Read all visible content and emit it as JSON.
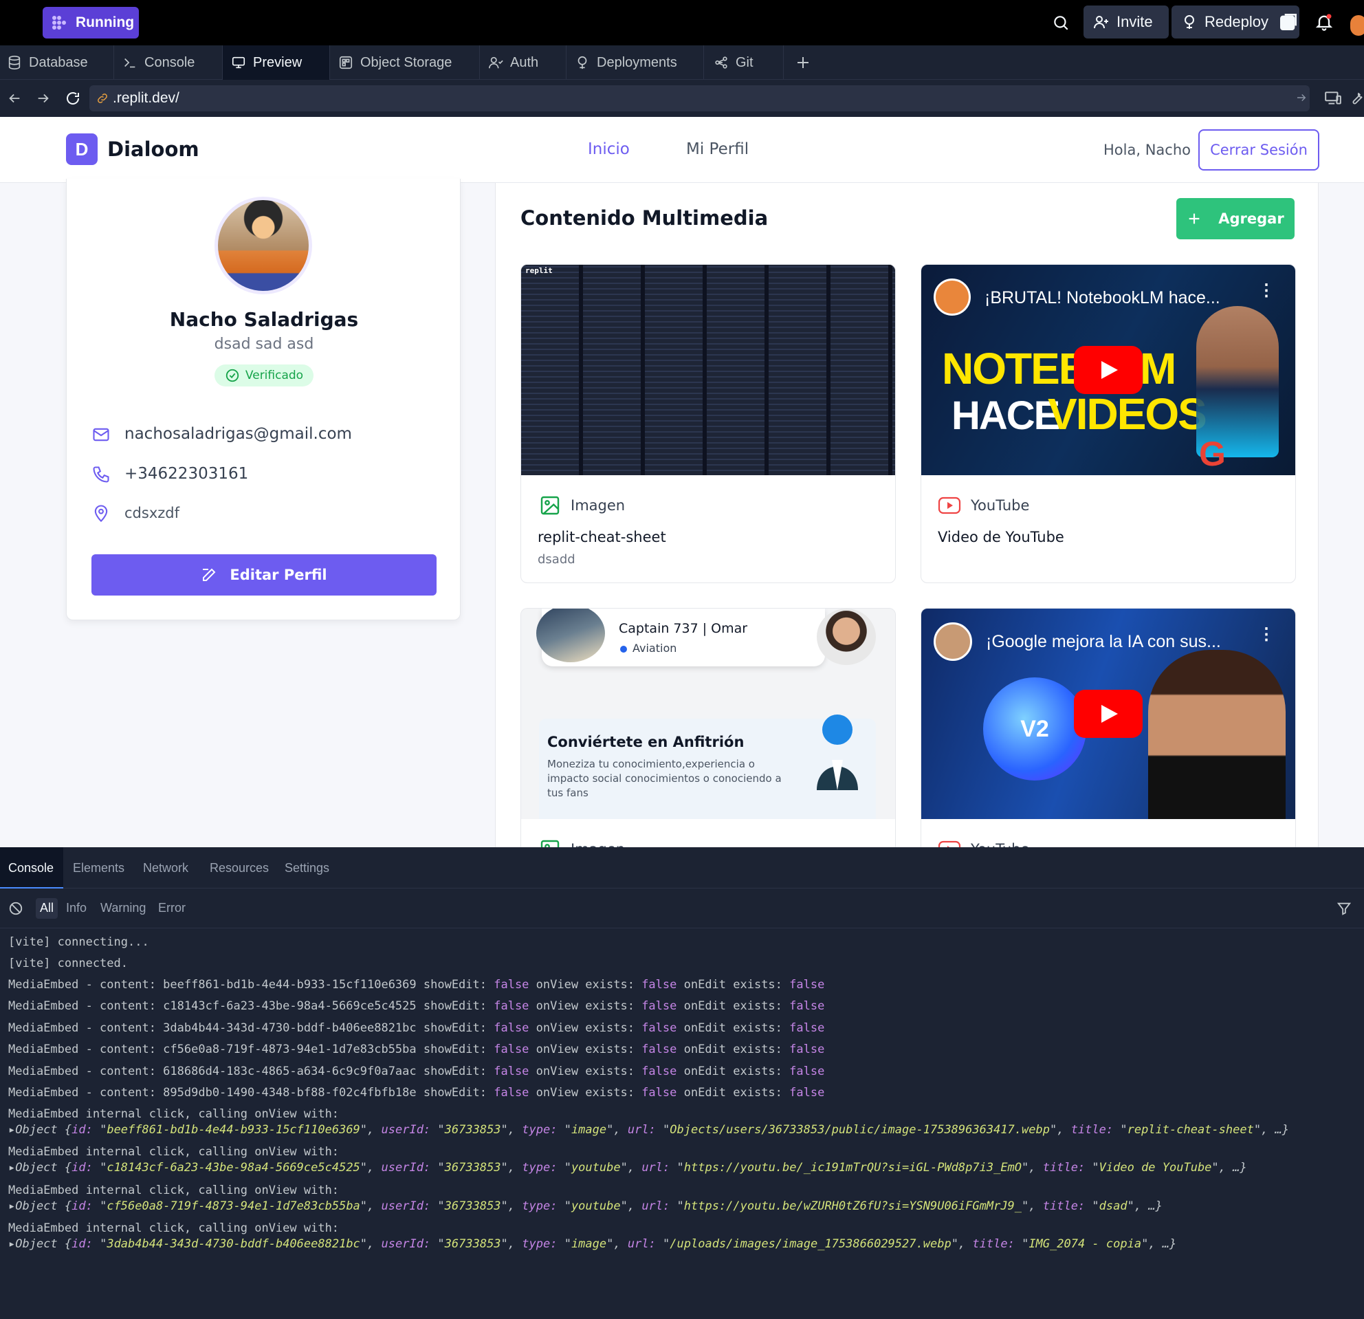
{
  "topbar": {
    "status": "Running",
    "invite": "Invite",
    "redeploy": "Redeploy",
    "colors": {
      "status_bg": "#5b3fd6",
      "notification_dot": "#ff3d3d"
    }
  },
  "tabs": [
    {
      "label": "Database",
      "icon": "database-icon"
    },
    {
      "label": "Console",
      "icon": "terminal-icon"
    },
    {
      "label": "Preview",
      "icon": "monitor-icon",
      "active": true
    },
    {
      "label": "Object Storage",
      "icon": "storage-icon"
    },
    {
      "label": "Auth",
      "icon": "user-icon"
    },
    {
      "label": "Deployments",
      "icon": "deploy-icon"
    },
    {
      "label": "Git",
      "icon": "git-icon"
    }
  ],
  "browser": {
    "url": ".replit.dev/"
  },
  "site": {
    "logo_letter": "D",
    "brand": "Dialoom",
    "nav": {
      "home": "Inicio",
      "profile": "Mi Perfil"
    },
    "greeting": "Hola, Nacho",
    "logout": "Cerrar Sesión",
    "colors": {
      "accent": "#6d5cf0",
      "agregar": "#2ec37c"
    }
  },
  "profile": {
    "name": "Nacho Saladrigas",
    "subtitle": "dsad sad asd",
    "badge": "Verificado",
    "email": "nachosaladrigas@gmail.com",
    "phone": "+34622303161",
    "location": "cdsxzdf",
    "edit": "Editar Perfil"
  },
  "media": {
    "title": "Contenido Multimedia",
    "add": "Agregar",
    "items": [
      {
        "type_label": "Imagen",
        "title": "replit-cheat-sheet",
        "description": "dsadd",
        "thumb_text": "replit"
      },
      {
        "type_label": "YouTube",
        "title": "Video de YouTube",
        "description": "",
        "thumb_title": "¡BRUTAL! NotebookLM hace...",
        "big1": "NOTEBO",
        "big1b": "M",
        "big2": "HACE",
        "big2b": "VIDEOS"
      },
      {
        "type_label": "Imagen",
        "title": "",
        "description": "",
        "captain": "Captain 737 | Omar",
        "aviation": "Aviation",
        "host_title": "Conviértete en Anfitrión",
        "host_text": "Moneziza tu conocimiento,experiencia o impacto social conocimientos o conociendo a tus fans"
      },
      {
        "type_label": "YouTube",
        "title": "",
        "description": "",
        "thumb_title": "¡Google mejora la IA con sus...",
        "badge": "V2"
      }
    ]
  },
  "devtools": {
    "tabs": [
      "Console",
      "Elements",
      "Network",
      "Resources",
      "Settings"
    ],
    "filters": [
      "All",
      "Info",
      "Warning",
      "Error"
    ],
    "lines": [
      "[vite] connecting...",
      "[vite] connected."
    ],
    "embeds": [
      "beeff861-bd1b-4e44-b933-15cf110e6369",
      "c18143cf-6a23-43be-98a4-5669ce5c4525",
      "3dab4b44-343d-4730-bddf-b406ee8821bc",
      "cf56e0a8-719f-4873-94e1-1d7e83cb55ba",
      "618686d4-183c-4865-a634-6c9c9f0a7aac",
      "895d9db0-1490-4348-bf88-f02c4fbfb18e"
    ],
    "embed_prefix": "MediaEmbed - content: ",
    "embed_suffix_a": " showEdit: ",
    "embed_suffix_b": " onView exists: ",
    "embed_suffix_c": " onEdit exists: ",
    "false_word": "false",
    "click_line": "MediaEmbed internal click, calling onView with:",
    "objects": [
      {
        "id": "beeff861-bd1b-4e44-b933-15cf110e6369",
        "userId": "36733853",
        "type": "image",
        "url": "Objects/users/36733853/public/image-1753896363417.webp",
        "title": "replit-cheat-sheet"
      },
      {
        "id": "c18143cf-6a23-43be-98a4-5669ce5c4525",
        "userId": "36733853",
        "type": "youtube",
        "url": "https://youtu.be/_ic191mTrQU?si=iGL-PWd8p7i3_EmO",
        "title": "Video de YouTube"
      },
      {
        "id": "cf56e0a8-719f-4873-94e1-1d7e83cb55ba",
        "userId": "36733853",
        "type": "youtube",
        "url": "https://youtu.be/wZURH0tZ6fU?si=YSN9U06iFGmMrJ9_",
        "title": "dsad"
      },
      {
        "id": "3dab4b44-343d-4730-bddf-b406ee8821bc",
        "userId": "36733853",
        "type": "image",
        "url": "/uploads/images/image_1753866029527.webp",
        "title": "IMG_2074 - copia"
      }
    ]
  }
}
